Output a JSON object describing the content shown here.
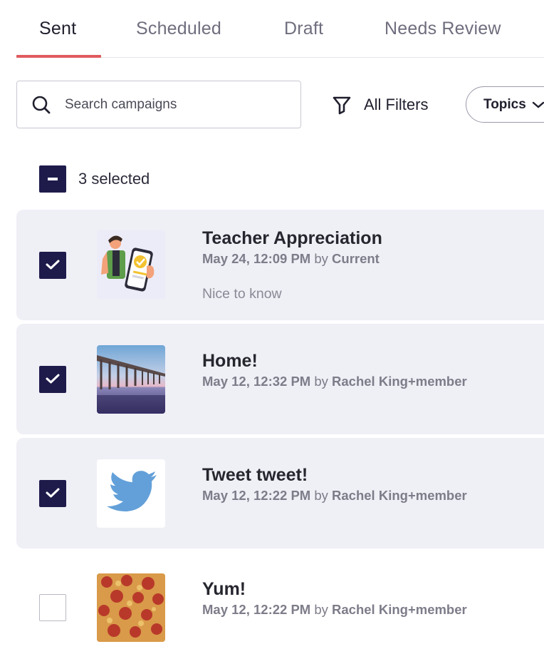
{
  "tabs": [
    {
      "label": "Sent",
      "active": true
    },
    {
      "label": "Scheduled",
      "active": false
    },
    {
      "label": "Draft",
      "active": false
    },
    {
      "label": "Needs Review",
      "active": false
    }
  ],
  "search": {
    "placeholder": "Search campaigns",
    "value": "",
    "icon": "search-icon"
  },
  "filters": {
    "all_filters_label": "All Filters",
    "icon": "filter-icon",
    "topics_label": "Topics"
  },
  "selection": {
    "count_label": "3 selected",
    "state": "indeterminate"
  },
  "colors": {
    "accent": "#e05a5e",
    "checkbox": "#1e1b4b",
    "selected_row": "#efeff6"
  },
  "campaigns": [
    {
      "title": "Teacher Appreciation",
      "date": "May 24, 12:09 PM",
      "by": "by",
      "author": "Current",
      "topic": "Nice to know",
      "checked": true,
      "thumbnail": "person-phone-review-illustration"
    },
    {
      "title": "Home!",
      "date": "May 12, 12:32 PM",
      "by": "by",
      "author": "Rachel King+member",
      "checked": true,
      "thumbnail": "pier-at-sunset-photo"
    },
    {
      "title": "Tweet tweet!",
      "date": "May 12, 12:22 PM",
      "by": "by",
      "author": "Rachel King+member",
      "checked": true,
      "thumbnail": "twitter-bird-logo"
    },
    {
      "title": "Yum!",
      "date": "May 12, 12:22 PM",
      "by": "by",
      "author": "Rachel King+member",
      "checked": false,
      "thumbnail": "pepperoni-pizza-photo"
    }
  ]
}
